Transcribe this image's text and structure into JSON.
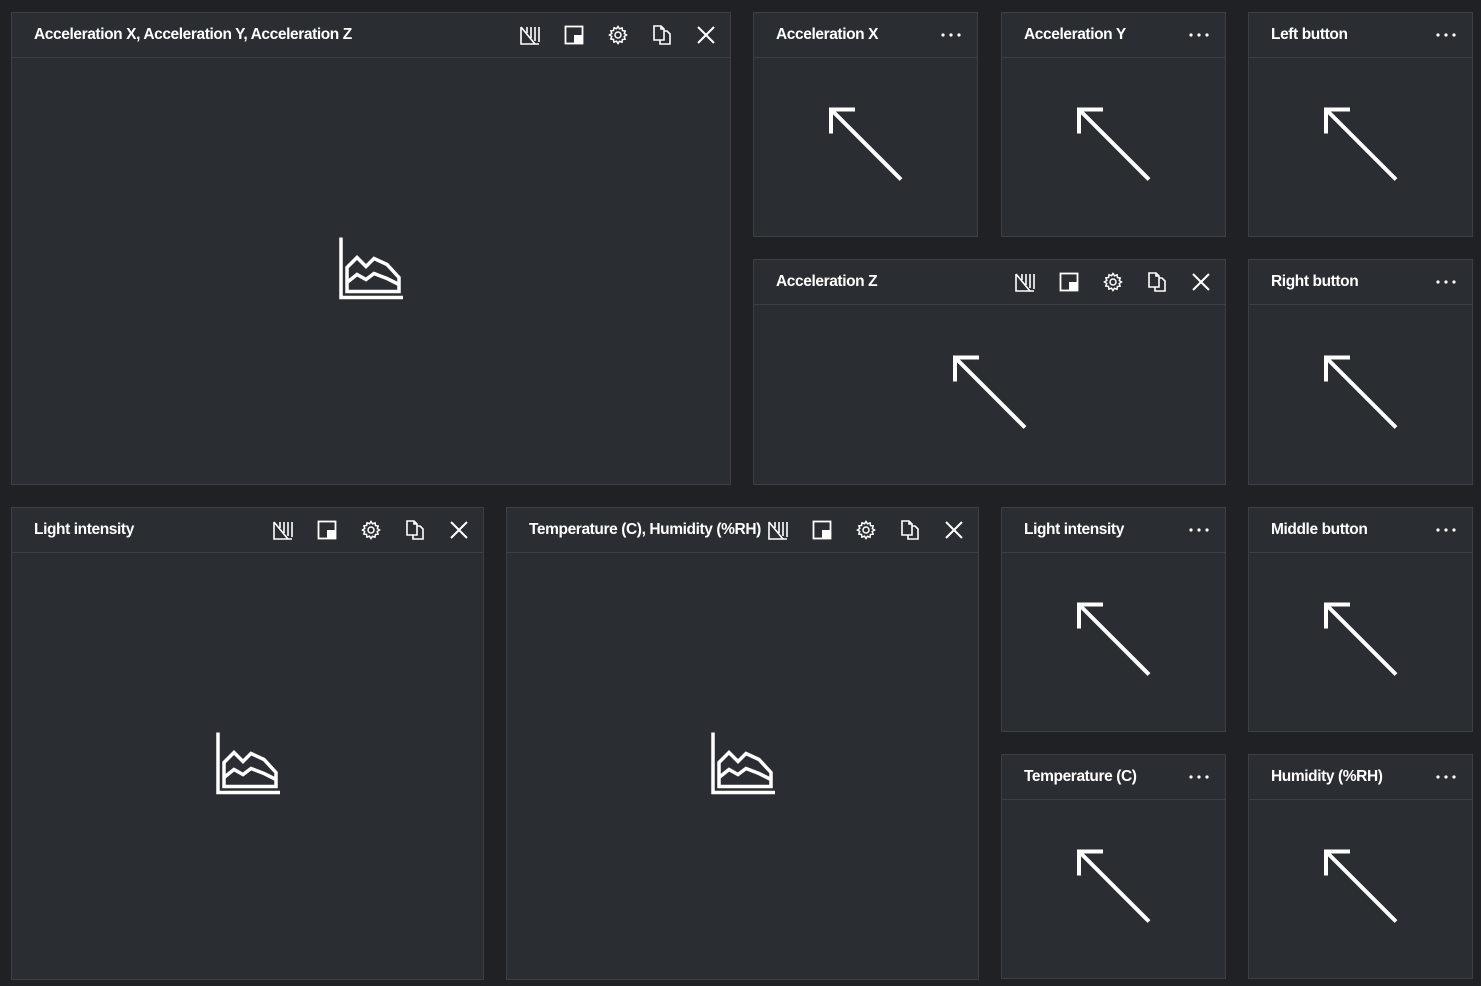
{
  "colors": {
    "background": "#1f2124",
    "tile": "#2a2d31",
    "border": "#3c3f44",
    "icon": "#ffffff",
    "text": "#ffffff"
  },
  "tiles": [
    {
      "title": "Acceleration X, Acceleration Y, Acceleration Z",
      "kind": "chart",
      "icon": "area-chart-icon"
    },
    {
      "title": "Acceleration X",
      "kind": "kpi",
      "icon": "arrow-up-left-icon"
    },
    {
      "title": "Acceleration Y",
      "kind": "kpi",
      "icon": "arrow-up-left-icon"
    },
    {
      "title": "Left button",
      "kind": "kpi",
      "icon": "arrow-up-left-icon"
    },
    {
      "title": "Acceleration Z",
      "kind": "kpi-wide",
      "icon": "arrow-up-left-icon"
    },
    {
      "title": "Right button",
      "kind": "kpi",
      "icon": "arrow-up-left-icon"
    },
    {
      "title": "Light intensity",
      "kind": "chart",
      "icon": "area-chart-icon"
    },
    {
      "title": "Temperature (C), Humidity (%RH)",
      "kind": "chart",
      "icon": "area-chart-icon"
    },
    {
      "title": "Light intensity",
      "kind": "kpi",
      "icon": "arrow-up-left-icon"
    },
    {
      "title": "Middle button",
      "kind": "kpi",
      "icon": "arrow-up-left-icon"
    },
    {
      "title": "Temperature (C)",
      "kind": "kpi",
      "icon": "arrow-up-left-icon"
    },
    {
      "title": "Humidity (%RH)",
      "kind": "kpi",
      "icon": "arrow-up-left-icon"
    }
  ],
  "toolbar_icons": [
    "diagnostics-icon",
    "pop-out-icon",
    "settings-gear-icon",
    "copy-icon",
    "close-icon"
  ],
  "more_icon": "more-options-icon"
}
